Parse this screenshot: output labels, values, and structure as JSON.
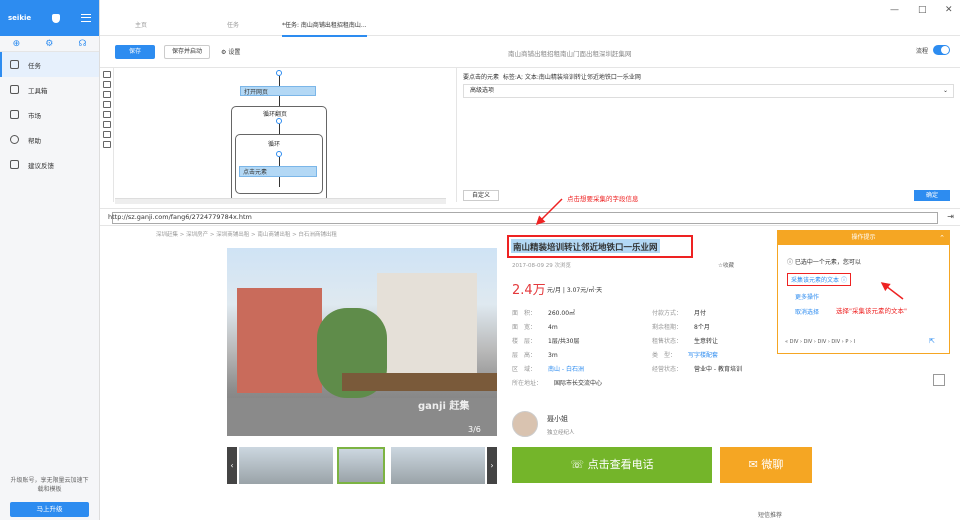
{
  "app": {
    "name": "seikie"
  },
  "sidebar": {
    "items": [
      {
        "label": "任务"
      },
      {
        "label": "工具箱"
      },
      {
        "label": "市场"
      },
      {
        "label": "帮助"
      },
      {
        "label": "建议反馈"
      }
    ],
    "upgrade_text": "升级账号，享无限量云加速下载和模板",
    "upgrade_button": "马上升级"
  },
  "tabs": [
    {
      "label": "主页"
    },
    {
      "label": "任务"
    },
    {
      "label": "*任务: 南山商铺出租招租南山..."
    }
  ],
  "toolbar": {
    "save": "保存",
    "save_start": "保存并启动",
    "settings": "设置",
    "task_title": "南山商铺出租招租南山门面出租深圳赶集网",
    "flow_label": "流程"
  },
  "flow": {
    "open_page": "打开网页",
    "loop_page": "循环翻页",
    "loop": "循环",
    "click_element": "点击元素"
  },
  "panel": {
    "selected_label": "要点击的元素",
    "selected_value": "标签:A; 文本:南山精装培训转让邻近地铁口一乐业网",
    "advanced": "高级选项",
    "define": "自定义",
    "confirm": "确定"
  },
  "url": "http://sz.ganji.com/fang6/2724779784x.htm",
  "annotations": {
    "top": "点击想要采集的字段信息",
    "right": "选择\"采集该元素的文本\""
  },
  "page": {
    "breadcrumb": "深圳赶集 > 深圳房产 > 深圳商铺出租 > 南山商铺出租 > 白石洲商铺出租",
    "title": "南山精装培训转让邻近地铁口一乐业网",
    "meta": "2017-08-09  29 次浏览",
    "fav": "收藏",
    "price": "2.4万",
    "price_unit": "元/月 | 3.07元/㎡·天",
    "photo_count": "3/6",
    "watermark": "ganji 赶集",
    "attrs_left": [
      {
        "k": "面　积：",
        "v": "260.00㎡"
      },
      {
        "k": "面　宽：",
        "v": "4m"
      },
      {
        "k": "楼　层：",
        "v": "1层/共30层"
      },
      {
        "k": "层　高：",
        "v": "3m"
      },
      {
        "k": "区　域：",
        "v": "南山 - 白石洲"
      },
      {
        "k": "所在地址：",
        "v": "国际市长交流中心"
      }
    ],
    "attrs_right": [
      {
        "k": "付款方式：",
        "v": "月付"
      },
      {
        "k": "剩余租期：",
        "v": "8个月"
      },
      {
        "k": "租售状态：",
        "v": "生意转让"
      },
      {
        "k": "类　型：",
        "v": "写字楼配套"
      },
      {
        "k": "经营状态：",
        "v": "营业中 - 教育培训"
      }
    ],
    "agent_name": "聂小姐",
    "agent_role": "独立经纪人",
    "call": "点击查看电话",
    "chat": "微聊",
    "share": "短信推荐"
  },
  "popup": {
    "title": "操作提示",
    "message": "已选中一个元素，您可以",
    "action1": "采集该元素的文本",
    "action2": "更多操作",
    "action3": "取消选择",
    "path": "« DIV › DIV › DIV › DIV › P › I"
  }
}
